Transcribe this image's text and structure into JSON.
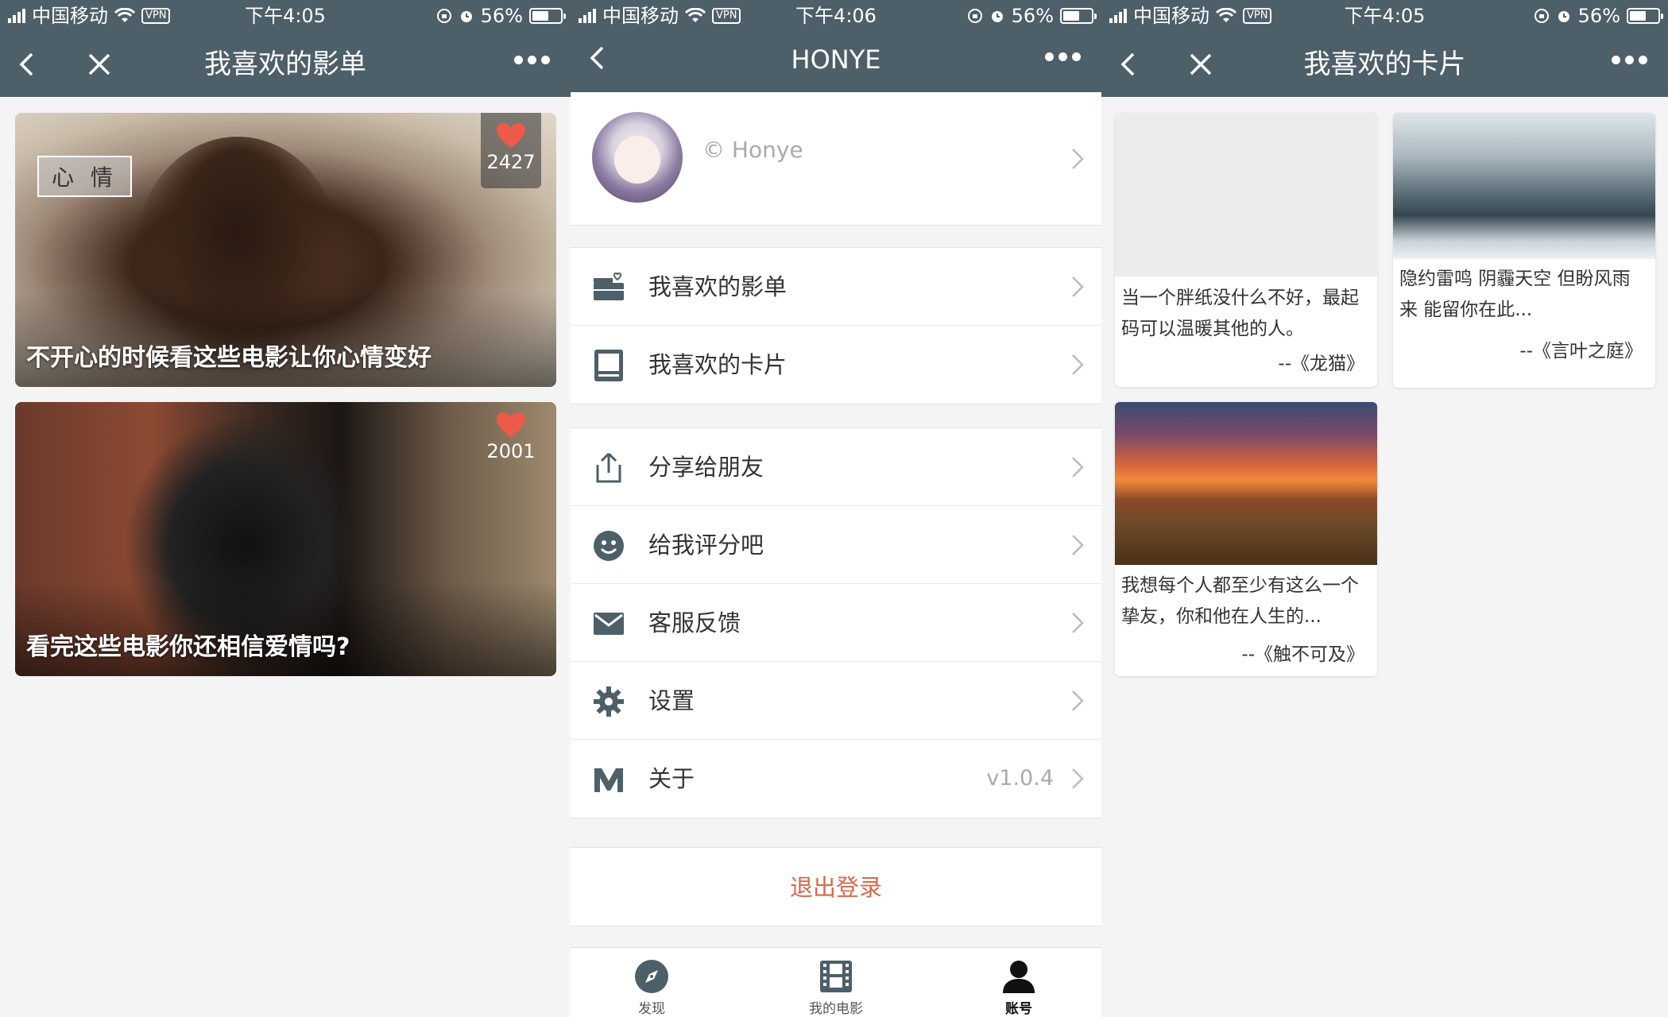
{
  "status_left": {
    "carrier": "中国移动",
    "vpn": "VPN",
    "time": "下午4:05",
    "battery": "56%"
  },
  "status_mid": {
    "carrier": "中国移动",
    "vpn": "VPN",
    "time": "下午4:06",
    "battery": "56%"
  },
  "status_right": {
    "carrier": "中国移动",
    "vpn": "VPN",
    "time": "下午4:05",
    "battery": "56%"
  },
  "screen1": {
    "title": "我喜欢的影单",
    "cards": [
      {
        "tag": "心 情",
        "likes": "2427",
        "title": "不开心的时候看这些电影让你心情变好"
      },
      {
        "likes": "2001",
        "title": "看完这些电影你还相信爱情吗?"
      }
    ]
  },
  "screen2": {
    "title": "HONYE",
    "profile_name": "© Honye",
    "menu_group1": [
      {
        "label": "我喜欢的影单",
        "icon": "film-list-icon"
      },
      {
        "label": "我喜欢的卡片",
        "icon": "card-icon"
      }
    ],
    "menu_group2": [
      {
        "label": "分享给朋友",
        "icon": "share-icon"
      },
      {
        "label": "给我评分吧",
        "icon": "smile-icon"
      },
      {
        "label": "客服反馈",
        "icon": "mail-icon"
      },
      {
        "label": "设置",
        "icon": "gear-icon"
      },
      {
        "label": "关于",
        "icon": "m-logo-icon",
        "value": "v1.0.4"
      }
    ],
    "logout": "退出登录",
    "tabs": [
      {
        "label": "发现",
        "icon": "compass-icon"
      },
      {
        "label": "我的电影",
        "icon": "film-icon"
      },
      {
        "label": "账号",
        "icon": "user-icon",
        "active": true
      }
    ]
  },
  "screen3": {
    "title": "我喜欢的卡片",
    "cards": [
      {
        "text": "当一个胖纸没什么不好，最起码可以温暖其他的人。",
        "source": "--《龙猫》"
      },
      {
        "text": "隐约雷鸣 阴霾天空 但盼风雨来 能留你在此...",
        "source": "--《言叶之庭》"
      },
      {
        "text": "我想每个人都至少有这么一个挚友，你和他在人生的...",
        "source": "--《触不可及》"
      }
    ]
  },
  "colors": {
    "nav_bg": "#4d5f69",
    "logout_red": "#d9674b",
    "heart": "#ee5a4a"
  }
}
